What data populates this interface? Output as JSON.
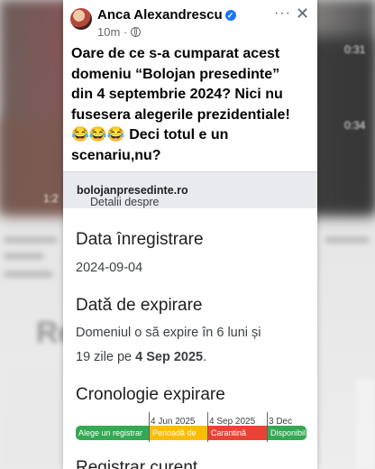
{
  "post": {
    "author": "Anca Alexandrescu",
    "time": "10m",
    "text_lines": [
      "Oare de ce s-a cumparat acest",
      "domeniu “Bolojan presedinte”",
      "din 4 septembrie 2024? Nici nu",
      "fusesera alegerile prezidentiale!",
      "😂😂😂 Deci totul e un",
      "scenariu,nu?"
    ]
  },
  "domain_card": {
    "prefix": "Detalii despre ",
    "domain": "bolojanpresedinte.ro",
    "registration_title": "Data înregistrare",
    "registration_date": "2024-09-04",
    "expiry_title": "Dată de expirare",
    "expiry_line1": "Domeniul o să expire în 6 luni și",
    "expiry_line2_pre": "19 zile pe ",
    "expiry_line2_bold": "4 Sep 2025",
    "expiry_line2_post": ".",
    "timeline_title": "Cronologie expirare",
    "timeline_dates": [
      "4 Jun 2025",
      "4 Sep 2025",
      "3 Dec"
    ],
    "timeline_segments": [
      "Alege un registrar",
      "Perioadă de",
      "Carantină",
      "Disponibil"
    ],
    "next_title": "Registrar curent"
  },
  "backdrop": {
    "times": [
      "1:2",
      "0:31",
      "0:34"
    ],
    "big_text": "Re"
  },
  "icons": {
    "verified": "verified-badge-icon",
    "visibility": "globe-icon",
    "more": "more-options-icon",
    "close": "close-icon"
  },
  "colors": {
    "accent": "#1877f2",
    "timeline_green": "#34a853",
    "timeline_orange": "#fbbc04",
    "timeline_red": "#ea4335"
  }
}
